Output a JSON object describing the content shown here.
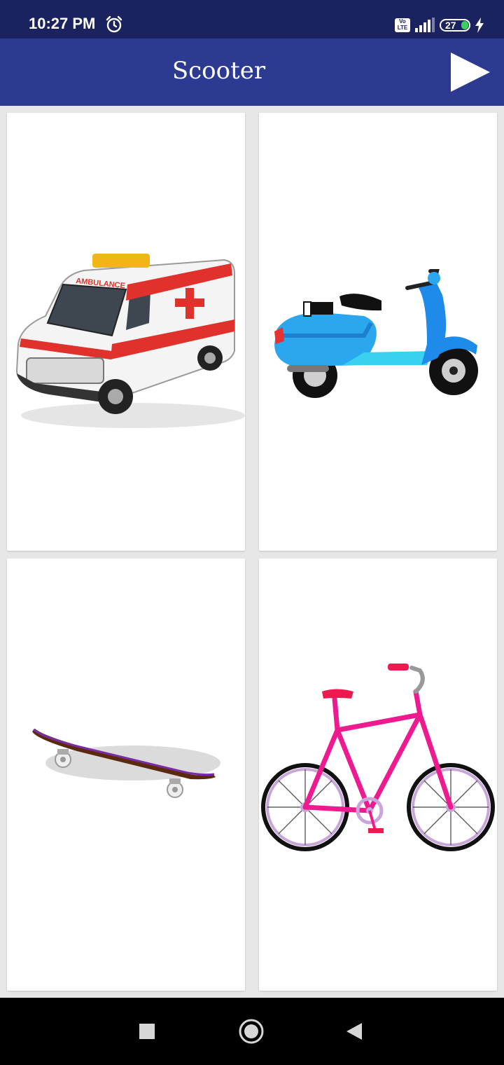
{
  "status_bar": {
    "time": "10:27 PM",
    "volte_line1": "Vo",
    "volte_line2": "LTE",
    "battery_level": "27",
    "icons": [
      "alarm-icon",
      "volte-icon",
      "signal-icon",
      "battery-icon",
      "charging-icon"
    ]
  },
  "app_bar": {
    "title": "Scooter",
    "play_icon": "play-icon"
  },
  "cards": [
    {
      "name": "ambulance",
      "label": "AMBULANCE"
    },
    {
      "name": "scooter"
    },
    {
      "name": "skateboard"
    },
    {
      "name": "bicycle"
    }
  ],
  "nav_bar": {
    "icons": [
      "recents-square-icon",
      "home-circle-icon",
      "back-triangle-icon"
    ]
  },
  "colors": {
    "status_bar": "#1b2260",
    "app_bar": "#2c3a91",
    "background": "#e6e6e6",
    "card": "#ffffff"
  }
}
